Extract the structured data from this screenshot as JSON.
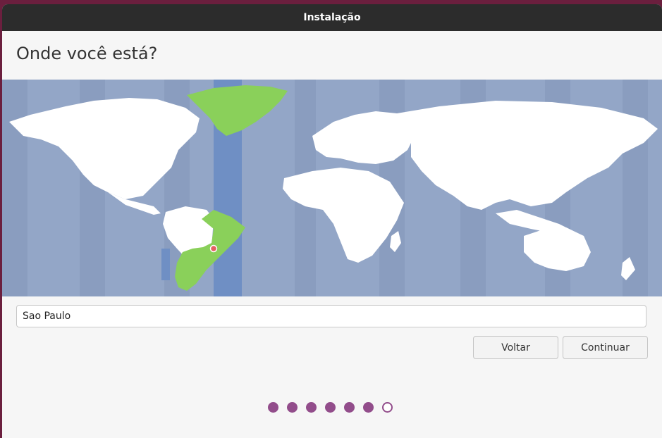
{
  "window": {
    "title": "Instalação"
  },
  "page": {
    "heading": "Onde você está?"
  },
  "timezone": {
    "value": "Sao Paulo",
    "selected_label": "Sao Paulo"
  },
  "buttons": {
    "back": "Voltar",
    "continue": "Continuar"
  },
  "progress": {
    "total_steps": 7,
    "completed_steps": 6
  },
  "colors": {
    "ocean": "#93a6c7",
    "land": "#ffffff",
    "selected_zone_band": "#6f8fc4",
    "selected_zone_land": "#8ad05a",
    "marker": "#e36060",
    "step_dot": "#924d8b"
  },
  "icons": {
    "location_marker": "map-pin-icon"
  }
}
